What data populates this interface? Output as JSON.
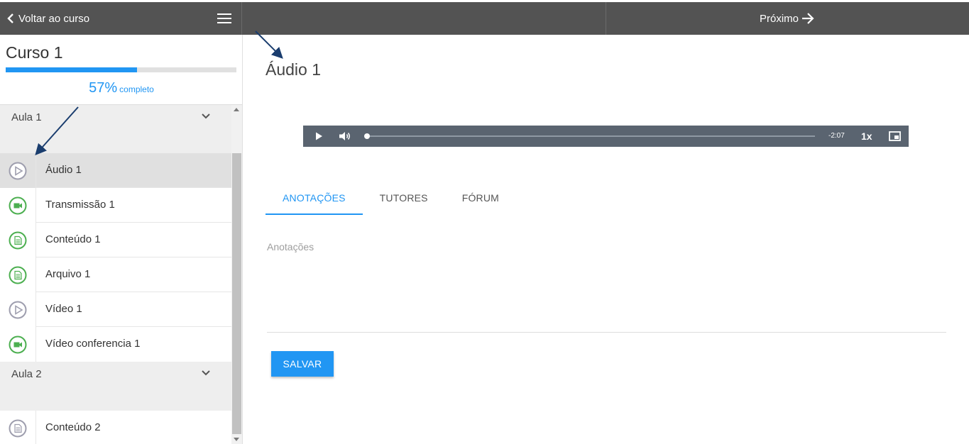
{
  "topbar": {
    "back_label": "Voltar ao curso",
    "next_label": "Próximo"
  },
  "sidebar": {
    "course_title": "Curso 1",
    "progress_percent": 57,
    "progress_text": "57%",
    "progress_suffix": "completo",
    "sections": [
      {
        "title": "Aula 1",
        "items": [
          {
            "label": "Áudio 1",
            "icon": "play-icon",
            "status": "pending",
            "active": true
          },
          {
            "label": "Transmissão 1",
            "icon": "video-camera-icon",
            "status": "done"
          },
          {
            "label": "Conteúdo 1",
            "icon": "document-icon",
            "status": "done"
          },
          {
            "label": "Arquivo 1",
            "icon": "document-icon",
            "status": "done"
          },
          {
            "label": "Vídeo 1",
            "icon": "play-icon",
            "status": "pending"
          },
          {
            "label": "Vídeo conferencia 1",
            "icon": "video-camera-icon",
            "status": "done"
          }
        ]
      },
      {
        "title": "Aula 2",
        "items": [
          {
            "label": "Conteúdo 2",
            "icon": "document-icon",
            "status": "pending"
          }
        ]
      }
    ]
  },
  "main": {
    "title": "Áudio 1",
    "player": {
      "time_remaining": "-2:07",
      "speed": "1x",
      "progress_fraction": 0
    },
    "tabs": [
      {
        "label": "ANOTAÇÕES",
        "active": true
      },
      {
        "label": "TUTORES",
        "active": false
      },
      {
        "label": "FÓRUM",
        "active": false
      }
    ],
    "notes_placeholder": "Anotações",
    "save_label": "SALVAR"
  },
  "colors": {
    "accent": "#2196f3",
    "done": "#4caf50",
    "pending": "#9e9eae",
    "topbar": "#535353"
  }
}
